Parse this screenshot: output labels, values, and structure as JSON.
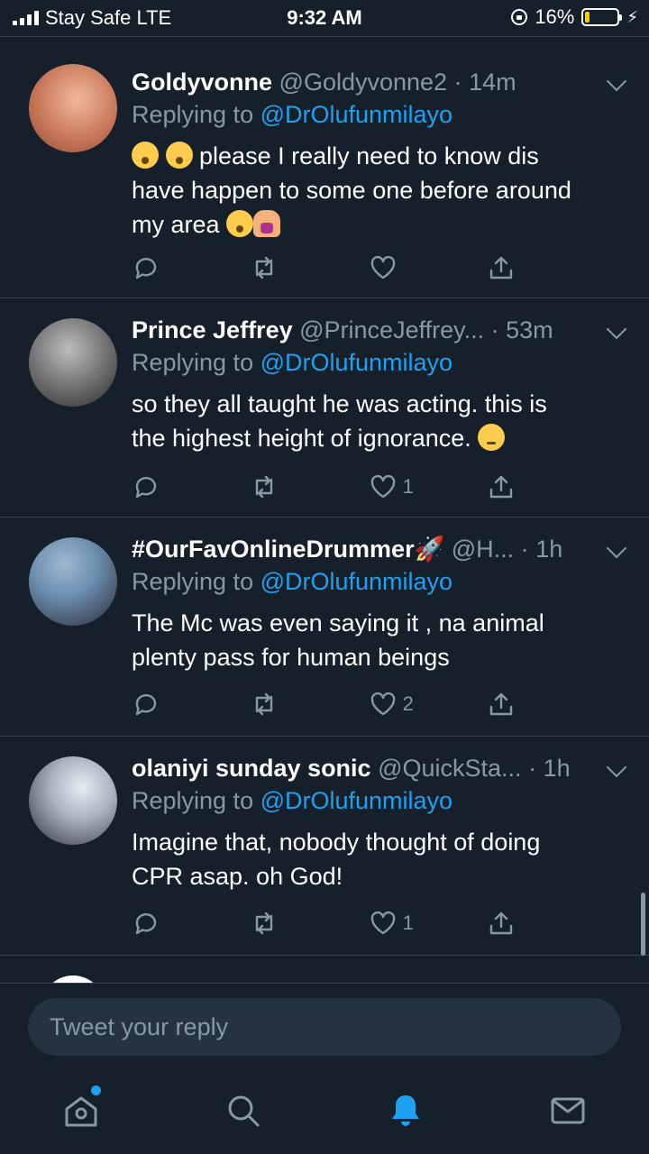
{
  "status_bar": {
    "carrier": "Stay Safe  LTE",
    "time": "9:32 AM",
    "battery": "16%",
    "battery_level": 0.16,
    "battery_color": "#ffcc00"
  },
  "colors": {
    "background": "#15202b",
    "accent": "#1da1f2",
    "muted": "#8899a6"
  },
  "tweets": [
    {
      "name": "Goldyvonne",
      "handle": "@Goldyvonne2",
      "dot": "·",
      "time": "14m",
      "replying_prefix": "Replying to",
      "mention": "@DrOlufunmilayo",
      "text_line1": " please I really need to know dis",
      "text_line2": "have happen to some one before around",
      "text_line3": "my area ",
      "likes": "",
      "avatar_colors": [
        "#c9785a",
        "#f0b89a"
      ]
    },
    {
      "name": "Prince Jeffrey",
      "handle": "@PrinceJeffrey...",
      "dot": "·",
      "time": "53m",
      "replying_prefix": "Replying to",
      "mention": "@DrOlufunmilayo",
      "text_line1": "so they all taught he was acting. this is",
      "text_line2": "the highest height of ignorance. ",
      "likes": "1",
      "avatar_colors": [
        "#4a4a4a",
        "#bdbdbd"
      ]
    },
    {
      "name": "#OurFavOnlineDrummer",
      "handle": "@H...",
      "dot": "·",
      "time": "1h",
      "replying_prefix": "Replying to",
      "mention": "@DrOlufunmilayo",
      "text_line1": "The Mc was even saying it , na animal",
      "text_line2": "plenty pass for human beings",
      "likes": "2",
      "avatar_colors": [
        "#6d8fb0",
        "#2b2b35"
      ]
    },
    {
      "name": "olaniyi sunday sonic",
      "handle": "@QuickSta...",
      "dot": "·",
      "time": "1h",
      "replying_prefix": "Replying to",
      "mention": "@DrOlufunmilayo",
      "text_line1": "Imagine that, nobody thought of doing",
      "text_line2": "CPR asap. oh God!",
      "likes": "1",
      "avatar_colors": [
        "#cfd6de",
        "#2c2f3a"
      ]
    }
  ],
  "reply_box": {
    "placeholder": "Tweet your reply"
  },
  "tabs": [
    "home-icon",
    "search-icon",
    "notifications-icon",
    "messages-icon"
  ]
}
